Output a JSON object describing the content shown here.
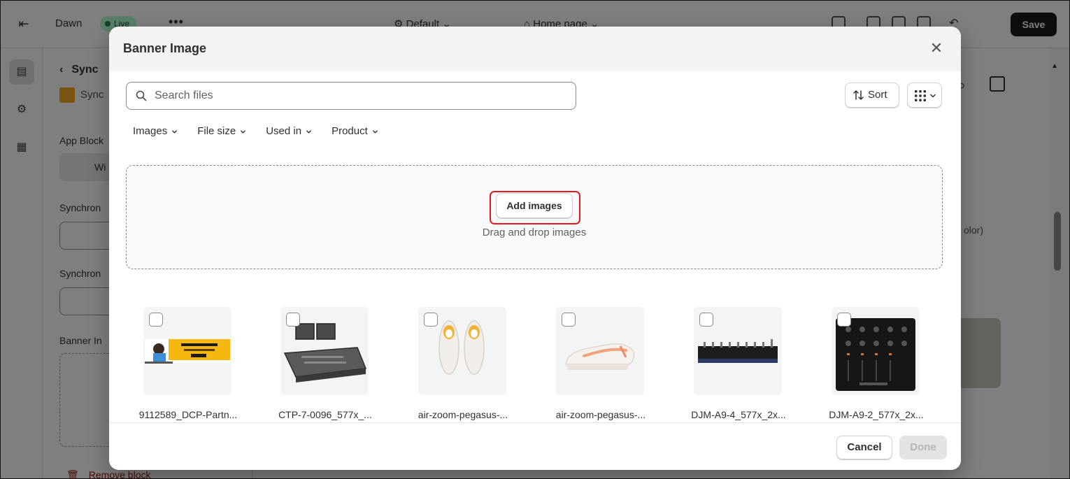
{
  "background": {
    "topbar": {
      "theme_name": "Dawn",
      "live_badge": "Live",
      "more": "•••",
      "template": "Default",
      "page": "Home page",
      "save_label": "Save"
    },
    "panel": {
      "back_title": "Sync",
      "sub_title": "Sync",
      "app_block_label": "App Block",
      "chip_label": "Wi",
      "field1_label": "Synchron",
      "field2_label": "Synchron",
      "banner_label": "Banner In",
      "remove_label": "Remove block"
    },
    "preview": {
      "partial_text": "olor)"
    }
  },
  "modal": {
    "title": "Banner Image",
    "search": {
      "placeholder": "Search files",
      "value": ""
    },
    "sort_label": "Sort",
    "filters": [
      "Images",
      "File size",
      "Used in",
      "Product"
    ],
    "dropzone": {
      "button_label": "Add images",
      "hint": "Drag and drop images"
    },
    "files": [
      {
        "name": "9112589_DCP-Partn..."
      },
      {
        "name": "CTP-7-0096_577x_..."
      },
      {
        "name": "air-zoom-pegasus-..."
      },
      {
        "name": "air-zoom-pegasus-..."
      },
      {
        "name": "DJM-A9-4_577x_2x..."
      },
      {
        "name": "DJM-A9-2_577x_2x..."
      }
    ],
    "footer": {
      "cancel_label": "Cancel",
      "done_label": "Done"
    }
  },
  "colors": {
    "highlight": "#e11b22",
    "primary_dark": "#1a1a1a",
    "live_green": "#b4fed2"
  }
}
